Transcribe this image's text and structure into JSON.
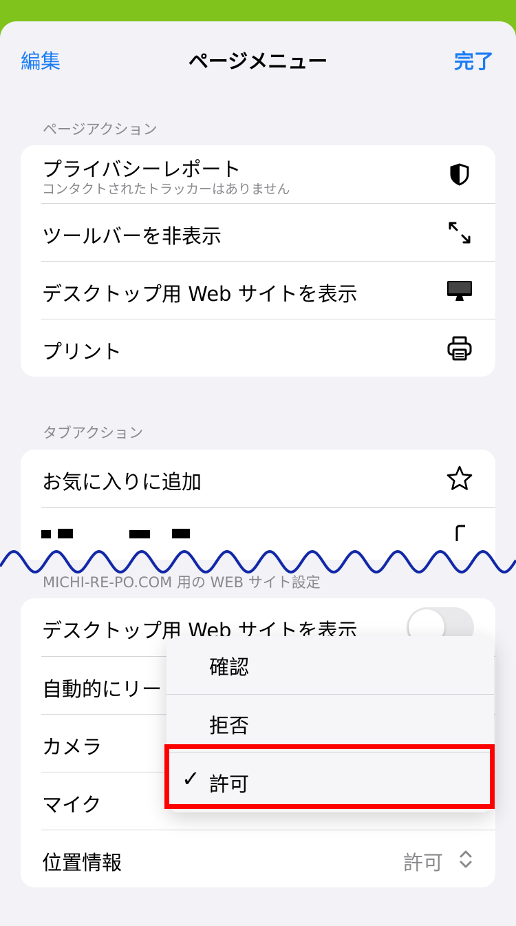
{
  "nav": {
    "edit": "編集",
    "title": "ページメニュー",
    "done": "完了"
  },
  "page_actions": {
    "header": "ページアクション",
    "items": [
      {
        "label": "プライバシーレポート",
        "sub": "コンタクトされたトラッカーはありません",
        "icon": "shield-half-icon"
      },
      {
        "label": "ツールバーを非表示",
        "icon": "expand-arrows-icon"
      },
      {
        "label": "デスクトップ用 Web サイトを表示",
        "icon": "desktop-monitor-icon"
      },
      {
        "label": "プリント",
        "icon": "printer-icon"
      }
    ]
  },
  "tab_actions": {
    "header": "タブアクション",
    "items": [
      {
        "label": "お気に入りに追加",
        "icon": "star-icon"
      }
    ]
  },
  "site_settings": {
    "header": "MICHI-RE-PO.COM 用の WEB サイト設定",
    "rows": [
      {
        "label": "デスクトップ用 Web サイトを表示",
        "toggle_on": false
      },
      {
        "label": "自動的にリー"
      },
      {
        "label": "カメラ"
      },
      {
        "label": "マイク"
      },
      {
        "label": "位置情報",
        "value": "許可"
      }
    ]
  },
  "popup": {
    "options": [
      "確認",
      "拒否",
      "許可"
    ],
    "selected": "許可",
    "check_mark": "✓"
  },
  "colors": {
    "accent": "#1a7cf5",
    "highlight": "#ff0000",
    "background_top": "#7fc31c"
  }
}
